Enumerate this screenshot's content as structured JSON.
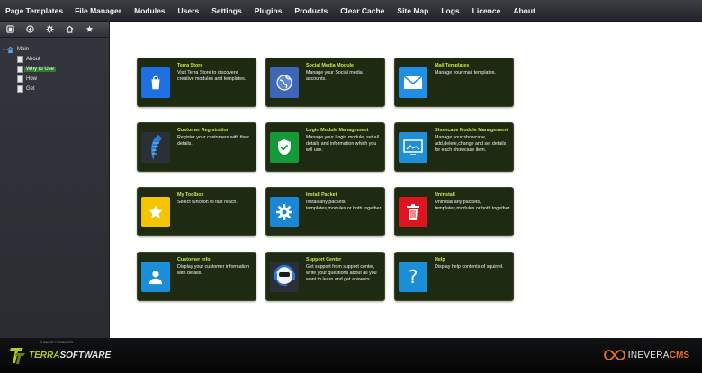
{
  "nav": {
    "items": [
      {
        "label": "Page Templates"
      },
      {
        "label": "File Manager"
      },
      {
        "label": "Modules"
      },
      {
        "label": "Users"
      },
      {
        "label": "Settings"
      },
      {
        "label": "Plugins"
      },
      {
        "label": "Products"
      },
      {
        "label": "Clear Cache"
      },
      {
        "label": "Site Map"
      },
      {
        "label": "Logs"
      },
      {
        "label": "Licence"
      },
      {
        "label": "About"
      }
    ]
  },
  "sidebar": {
    "toolbar_icons": [
      "page-icon",
      "add-circle-icon",
      "gear-icon",
      "home-icon",
      "star-icon"
    ],
    "tree": {
      "root": "Main",
      "children": [
        "About",
        "Why to Use",
        "How",
        "Get"
      ],
      "selected": "Why to Use"
    }
  },
  "tiles": [
    {
      "title": "Terra Store",
      "desc": "Visit Terra Store to discovere creative modules and templates.",
      "icon": "shopping-bag-icon",
      "color": "#1e6fe0"
    },
    {
      "title": "Social Media Module",
      "desc": "Manage your Social media accounts.",
      "icon": "globe-icon",
      "color": "#3e66b8"
    },
    {
      "title": "Mail Templates",
      "desc": "Manage your mail templates.",
      "icon": "envelope-icon",
      "color": "#1f8fe6"
    },
    {
      "title": "Customer Registration",
      "desc": "Register your customers with their details.",
      "icon": "feather-icon",
      "color": "#2b2f36"
    },
    {
      "title": "Login Module Management",
      "desc": "Manage your Login module, set all details and information which you will use.",
      "icon": "shield-check-icon",
      "color": "#159a3a"
    },
    {
      "title": "Showcase Module Management",
      "desc": "Manage your showcase, add,delete,change and set details for each showcase item.",
      "icon": "monitor-icon",
      "color": "#1d90d8"
    },
    {
      "title": "My Toolbox",
      "desc": "Select function to fast reach.",
      "icon": "star-icon",
      "color": "#f2c500"
    },
    {
      "title": "Install Packet",
      "desc": "Install any packets, templates,modules or both together.",
      "icon": "gear-icon",
      "color": "#1a86d6"
    },
    {
      "title": "Uninstall",
      "desc": "Uninstall any packets, templates,modules or both together.",
      "icon": "trash-icon",
      "color": "#e0141e"
    },
    {
      "title": "Customer Info",
      "desc": "Display your customer information with details.",
      "icon": "user-icon",
      "color": "#1a8ed6"
    },
    {
      "title": "Support Center",
      "desc": "Get support from support center, write your questions about all you want to learn and get answers.",
      "icon": "headset-icon",
      "color": "#2b2f36"
    },
    {
      "title": "Help",
      "desc": "Display help contents of squirrel.",
      "icon": "question-icon",
      "color": "#1a8ed6"
    }
  ],
  "footer": {
    "left_brand_a": "TERRA",
    "left_brand_b": "SOFTWARE",
    "left_tagline": "THINK OF PRODUCTS",
    "right_brand_a": "INEVERA",
    "right_brand_b": "CMS"
  }
}
